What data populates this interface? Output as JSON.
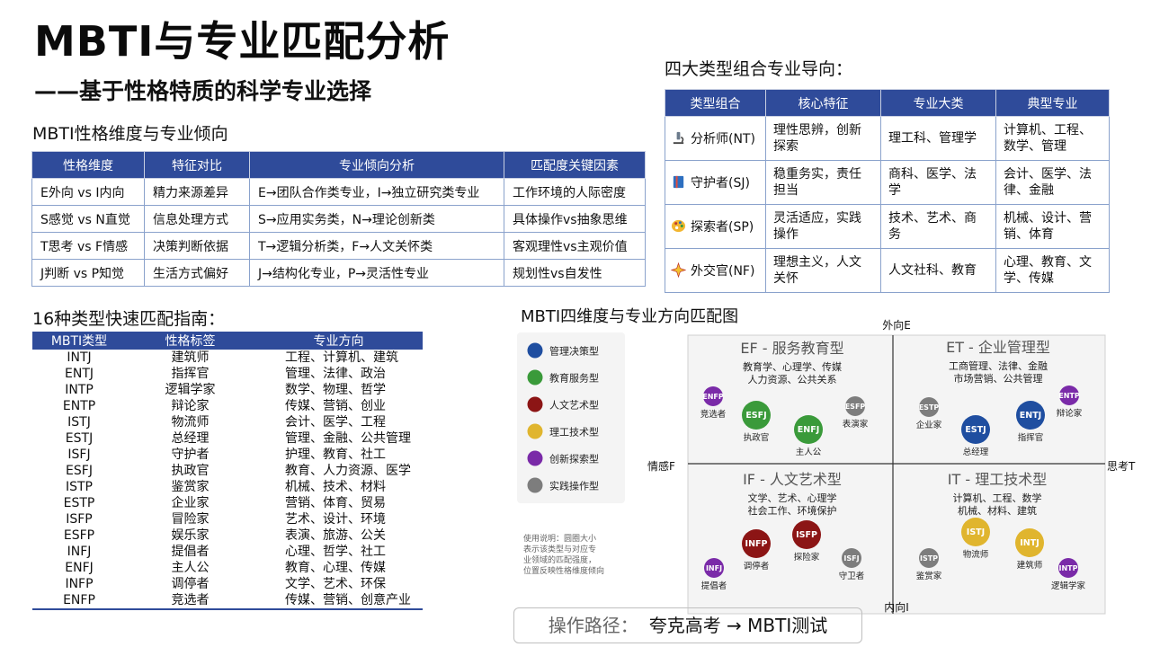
{
  "title": "MBTI与专业匹配分析",
  "subtitle": "——基于性格特质的科学专业选择",
  "dimensions": {
    "heading": "MBTI性格维度与专业倾向",
    "headers": [
      "性格维度",
      "特征对比",
      "专业倾向分析",
      "匹配度关键因素"
    ],
    "rows": [
      [
        "E外向 vs I内向",
        "精力来源差异",
        "E→团队合作类专业，I→独立研究类专业",
        "工作环境的人际密度"
      ],
      [
        "S感觉 vs N直觉",
        "信息处理方式",
        "S→应用实务类，N→理论创新类",
        "具体操作vs抽象思维"
      ],
      [
        "T思考 vs F情感",
        "决策判断依据",
        "T→逻辑分析类，F→人文关怀类",
        "客观理性vs主观价值"
      ],
      [
        "J判断 vs P知觉",
        "生活方式偏好",
        "J→结构化专业，P→灵活性专业",
        "规划性vs自发性"
      ]
    ]
  },
  "four_types": {
    "heading": "四大类型组合专业导向：",
    "headers": [
      "类型组合",
      "核心特征",
      "专业大类",
      "典型专业"
    ],
    "rows": [
      {
        "icon": "microscope-icon",
        "group": "分析师(NT)",
        "trait": "理性思辨，创新探索",
        "category": "理工科、管理学",
        "majors": "计算机、工程、数学、管理"
      },
      {
        "icon": "book-icon",
        "group": "守护者(SJ)",
        "trait": "稳重务实，责任担当",
        "category": "商科、医学、法学",
        "majors": "会计、医学、法律、金融"
      },
      {
        "icon": "palette-icon",
        "group": "探索者(SP)",
        "trait": "灵活适应，实践操作",
        "category": "技术、艺术、商务",
        "majors": "机械、设计、营销、体育"
      },
      {
        "icon": "sparkle-icon",
        "group": "外交官(NF)",
        "trait": "理想主义，人文关怀",
        "category": "人文社科、教育",
        "majors": "心理、教育、文学、传媒"
      }
    ]
  },
  "quick_guide": {
    "heading": "16种类型快速匹配指南：",
    "headers": [
      "MBTI类型",
      "性格标签",
      "专业方向"
    ],
    "rows": [
      [
        "INTJ",
        "建筑师",
        "工程、计算机、建筑"
      ],
      [
        "ENTJ",
        "指挥官",
        "管理、法律、政治"
      ],
      [
        "INTP",
        "逻辑学家",
        "数学、物理、哲学"
      ],
      [
        "ENTP",
        "辩论家",
        "传媒、营销、创业"
      ],
      [
        "ISTJ",
        "物流师",
        "会计、医学、工程"
      ],
      [
        "ESTJ",
        "总经理",
        "管理、金融、公共管理"
      ],
      [
        "ISFJ",
        "守护者",
        "护理、教育、社工"
      ],
      [
        "ESFJ",
        "执政官",
        "教育、人力资源、医学"
      ],
      [
        "ISTP",
        "鉴赏家",
        "机械、技术、材料"
      ],
      [
        "ESTP",
        "企业家",
        "营销、体育、贸易"
      ],
      [
        "ISFP",
        "冒险家",
        "艺术、设计、环境"
      ],
      [
        "ESFP",
        "娱乐家",
        "表演、旅游、公关"
      ],
      [
        "INFJ",
        "提倡者",
        "心理、哲学、社工"
      ],
      [
        "ENFJ",
        "主人公",
        "教育、心理、传媒"
      ],
      [
        "INFP",
        "调停者",
        "文学、艺术、环保"
      ],
      [
        "ENFP",
        "竞选者",
        "传媒、营销、创意产业"
      ]
    ]
  },
  "matrix": {
    "heading": "MBTI四维度与专业方向匹配图",
    "axes": {
      "top": "外向E",
      "bottom": "内向I",
      "left": "情感F",
      "right": "思考T"
    },
    "colors": {
      "manage": "#1f4ea0",
      "education": "#3a9a3a",
      "art": "#8c1515",
      "tech": "#e0b52e",
      "innovate": "#7a2aa8",
      "practice": "#7d7d7d"
    },
    "legend": [
      {
        "label": "管理决策型",
        "key": "manage"
      },
      {
        "label": "教育服务型",
        "key": "education"
      },
      {
        "label": "人文艺术型",
        "key": "art"
      },
      {
        "label": "理工技术型",
        "key": "tech"
      },
      {
        "label": "创新探索型",
        "key": "innovate"
      },
      {
        "label": "实践操作型",
        "key": "practice"
      }
    ],
    "note": [
      "使用说明：圆圈大小",
      "表示该类型与对应专",
      "业领域的匹配强度，",
      "位置反映性格维度倾向"
    ],
    "quadrants": [
      {
        "title": "EF - 服务教育型",
        "lines": [
          "教育学、心理学、传媒",
          "人力资源、公共关系"
        ]
      },
      {
        "title": "ET - 企业管理型",
        "lines": [
          "工商管理、法律、金融",
          "市场营销、公共管理"
        ]
      },
      {
        "title": "IF - 人文艺术型",
        "lines": [
          "文学、艺术、心理学",
          "社会工作、环境保护"
        ]
      },
      {
        "title": "IT - 理工技术型",
        "lines": [
          "计算机、工程、数学",
          "机械、材料、建筑"
        ]
      }
    ],
    "bubbles": [
      {
        "code": "ENFP",
        "label": "竞选者",
        "key": "innovate",
        "size": "s"
      },
      {
        "code": "ESFJ",
        "label": "执政官",
        "key": "education",
        "size": "l"
      },
      {
        "code": "ENFJ",
        "label": "主人公",
        "key": "education",
        "size": "l"
      },
      {
        "code": "ESFP",
        "label": "表演家",
        "key": "practice",
        "size": "s"
      },
      {
        "code": "ESTP",
        "label": "企业家",
        "key": "practice",
        "size": "s"
      },
      {
        "code": "ESTJ",
        "label": "总经理",
        "key": "manage",
        "size": "l"
      },
      {
        "code": "ENTJ",
        "label": "指挥官",
        "key": "manage",
        "size": "l"
      },
      {
        "code": "ENTP",
        "label": "辩论家",
        "key": "innovate",
        "size": "s"
      },
      {
        "code": "INFP",
        "label": "调停者",
        "key": "art",
        "size": "l"
      },
      {
        "code": "ISFP",
        "label": "探险家",
        "key": "art",
        "size": "l"
      },
      {
        "code": "ISFJ",
        "label": "守卫者",
        "key": "practice",
        "size": "s"
      },
      {
        "code": "INFJ",
        "label": "提倡者",
        "key": "innovate",
        "size": "s"
      },
      {
        "code": "ISTP",
        "label": "鉴赏家",
        "key": "practice",
        "size": "s"
      },
      {
        "code": "ISTJ",
        "label": "物流师",
        "key": "tech",
        "size": "l"
      },
      {
        "code": "INTJ",
        "label": "建筑师",
        "key": "tech",
        "size": "l"
      },
      {
        "code": "INTP",
        "label": "逻辑学家",
        "key": "innovate",
        "size": "s"
      }
    ]
  },
  "route": {
    "label": "操作路径：",
    "text": "夸克高考 → MBTI测试"
  }
}
